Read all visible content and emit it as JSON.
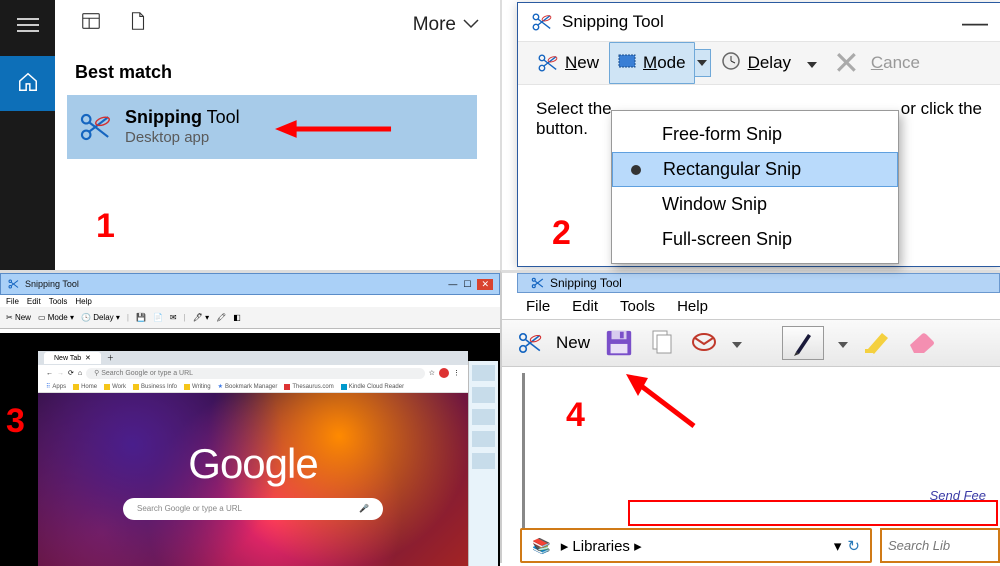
{
  "step_labels": {
    "s1": "1",
    "s2": "2",
    "s3": "3",
    "s4": "4"
  },
  "p1": {
    "more": "More",
    "heading": "Best match",
    "result_title_bold": "Snipping",
    "result_title_rest": " Tool",
    "result_sub": "Desktop app"
  },
  "p2": {
    "window_title": "Snipping Tool",
    "btn_new": "New",
    "btn_mode": "Mode",
    "btn_delay": "Delay",
    "btn_cancel": "Cancel",
    "msg_left": "Select the",
    "msg_left2": "button.",
    "msg_right": "or click the",
    "menu": {
      "freeform": "Free-form Snip",
      "rect": "Rectangular Snip",
      "window": "Window Snip",
      "full": "Full-screen Snip"
    }
  },
  "p3": {
    "win_title": "Snipping Tool",
    "menus": {
      "file": "File",
      "edit": "Edit",
      "tools": "Tools",
      "help": "Help"
    },
    "toolbar": {
      "new": "New",
      "mode": "Mode",
      "delay": "Delay"
    },
    "browser_tab": "New Tab",
    "addr_placeholder": "Search Google or type a URL",
    "bookmarks": {
      "apps": "Apps",
      "home": "Home",
      "work": "Work",
      "biz": "Business Info",
      "writing": "Writing",
      "bm": "Bookmark Manager",
      "thes": "Thesaurus.com",
      "kindle": "Kindle Cloud Reader"
    },
    "google": "Google",
    "search_placeholder": "Search Google or type a URL"
  },
  "p4": {
    "win_title": "Snipping Tool",
    "menus": {
      "file": "File",
      "edit": "Edit",
      "tools": "Tools",
      "help": "Help"
    },
    "btn_new": "New",
    "feedback": "Send Fee",
    "explorer_loc": "Libraries",
    "explorer_search": "Search Lib"
  }
}
